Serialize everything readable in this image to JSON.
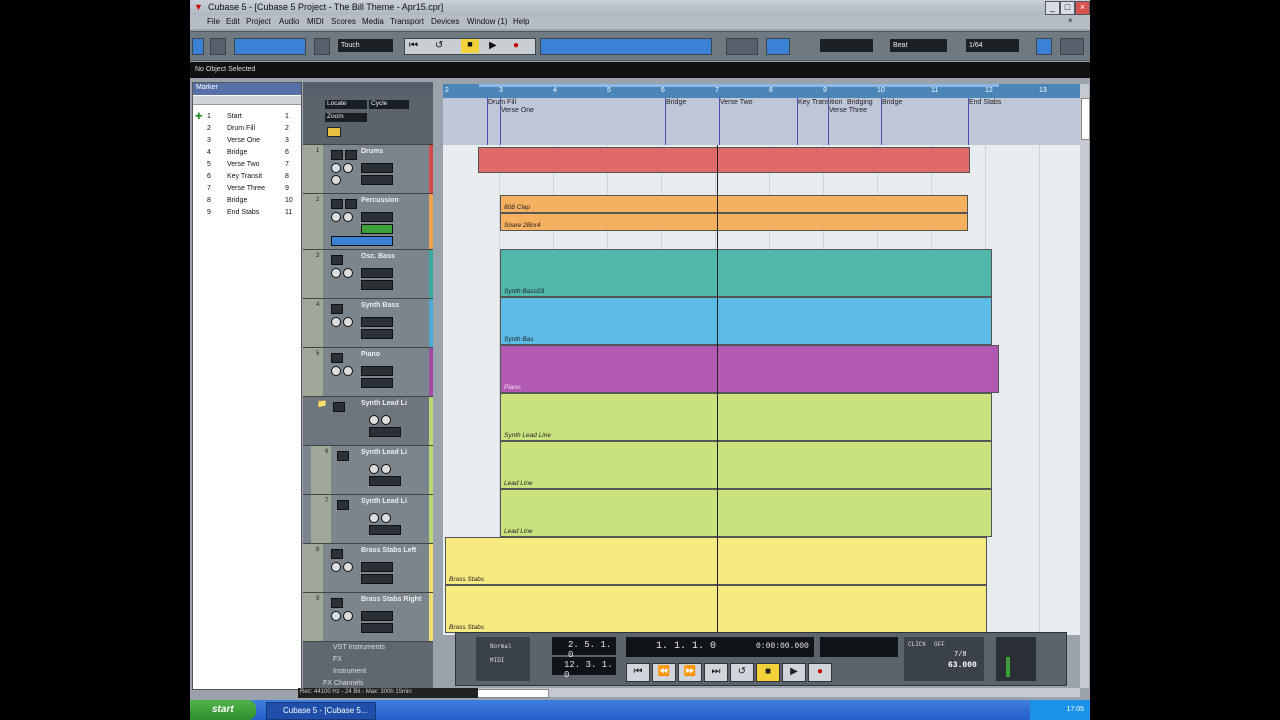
{
  "window": {
    "title": "Cubase 5 - [Cubase 5 Project - The Bill Theme - Apr15.cpr]"
  },
  "menu": [
    "File",
    "Edit",
    "Project",
    "Audio",
    "MIDI",
    "Scores",
    "Media",
    "Transport",
    "Devices",
    "Window (1)",
    "Help"
  ],
  "toolbar": {
    "automation_mode": "Touch",
    "quantize": "Beat",
    "grid": "1/64"
  },
  "infoline": "No Object Selected",
  "marker_panel": {
    "title": "Marker",
    "rows": [
      {
        "n": "1",
        "name": "Start",
        "id": "1"
      },
      {
        "n": "2",
        "name": "Drum Fill",
        "id": "2"
      },
      {
        "n": "3",
        "name": "Verse One",
        "id": "3"
      },
      {
        "n": "4",
        "name": "Bridge",
        "id": "6"
      },
      {
        "n": "5",
        "name": "Verse Two",
        "id": "7"
      },
      {
        "n": "6",
        "name": "Key Transit",
        "id": "8"
      },
      {
        "n": "7",
        "name": "Verse Three",
        "id": "9"
      },
      {
        "n": "8",
        "name": "Bridge",
        "id": "10"
      },
      {
        "n": "9",
        "name": "End Stabs",
        "id": "11"
      }
    ]
  },
  "ruler": [
    "2",
    "3",
    "4",
    "5",
    "6",
    "7",
    "8",
    "9",
    "10",
    "11",
    "12",
    "13"
  ],
  "markers": [
    {
      "label": "Drum Fill"
    },
    {
      "label": "Verse One"
    },
    {
      "label": "Bridge"
    },
    {
      "label": "Verse Two"
    },
    {
      "label": "Key Transition"
    },
    {
      "label": "Bridging"
    },
    {
      "label": "Verse Three"
    },
    {
      "label": "Bridge"
    },
    {
      "label": "End Stabs"
    }
  ],
  "marker_controls": {
    "locate": "Locate",
    "cycle": "Cycle",
    "zoom": "Zoom"
  },
  "tracks": [
    {
      "num": "1",
      "name": "Drums",
      "color": "#d24a4a"
    },
    {
      "num": "2",
      "name": "Percussion",
      "color": "#f0a24a"
    },
    {
      "num": "3",
      "name": "Osc. Bass",
      "color": "#3aa89a"
    },
    {
      "num": "4",
      "name": "Synth Bass",
      "color": "#4aaad8"
    },
    {
      "num": "5",
      "name": "Piano",
      "color": "#a04aa0"
    },
    {
      "num": "",
      "name": "Synth Lead Li",
      "color": "#b8d870"
    },
    {
      "num": "6",
      "name": "Synth Lead Li",
      "color": "#b8d870"
    },
    {
      "num": "7",
      "name": "Synth Lead Li",
      "color": "#b8d870"
    },
    {
      "num": "8",
      "name": "Brass Stabs Left",
      "color": "#f0e070"
    },
    {
      "num": "9",
      "name": "Brass Stabs Right",
      "color": "#f0e070"
    }
  ],
  "folders": [
    "VST Instruments",
    "FX",
    "Instrument",
    "FX Channels"
  ],
  "part_labels": {
    "perc_top": "808 Clap",
    "perc_bottom": "Snare 2Bnr4",
    "osc": "Synth Bass03",
    "synthbass": "Synth Bas",
    "piano": "Piano",
    "lead": "Synth Lead Line",
    "leadlane": "Lead Line",
    "brass": "Brass Stabs"
  },
  "transport": {
    "mode": "Normal",
    "sync": "MIDI",
    "left_locator": "2. 5. 1. 0",
    "right_locator": "12. 3. 1. 0",
    "position_bars": "1. 1. 1.   0",
    "position_time": "0:00:00.000",
    "click": "CLICK",
    "click_state": "OFF",
    "tempo": "63.000",
    "sig": "7/8"
  },
  "status": "Rec: 44100 Hz - 24 Bit - Max: 300h 15min",
  "taskbar": {
    "start": "start",
    "item": "Cubase 5 - [Cubase 5...",
    "clock": "17:05"
  }
}
